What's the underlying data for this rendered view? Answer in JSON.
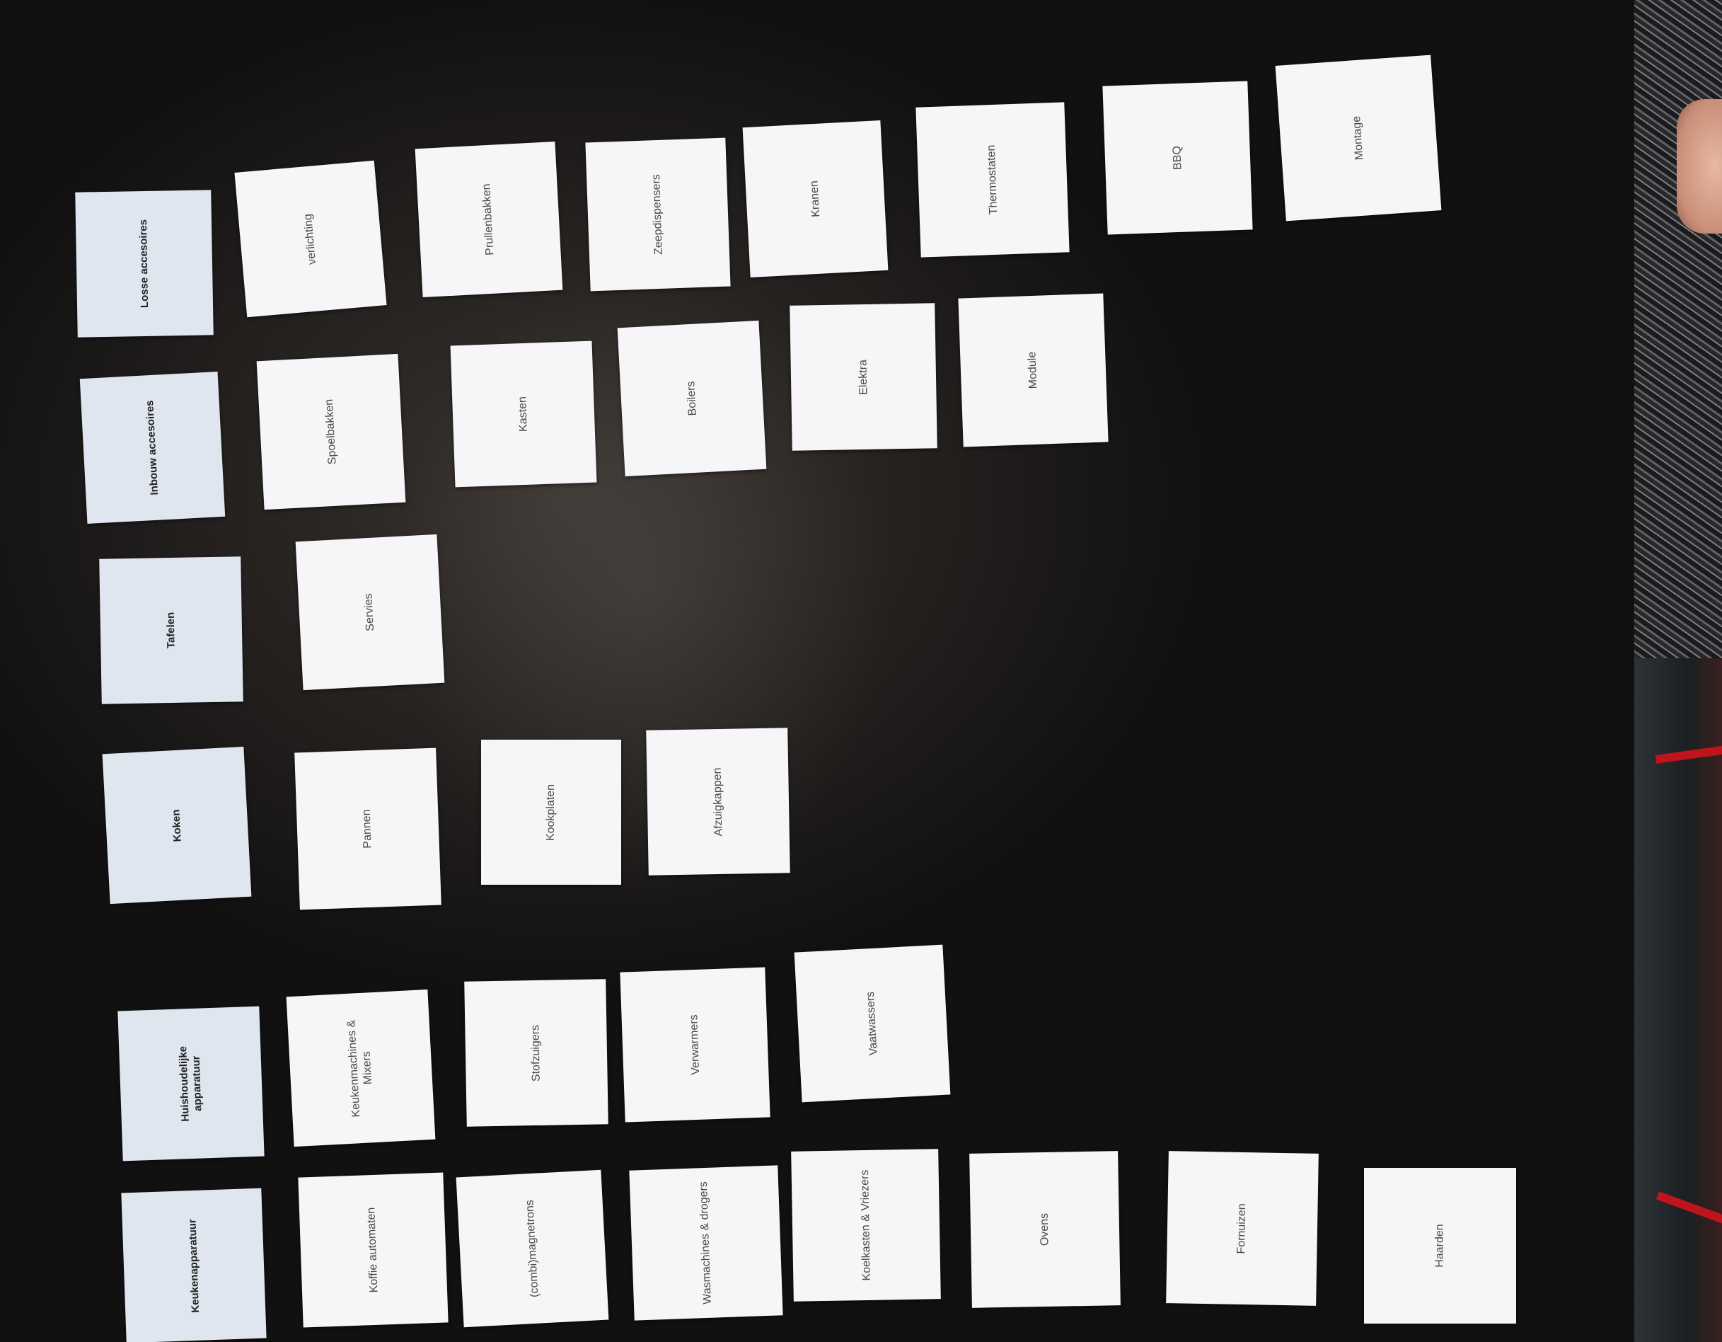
{
  "cards": {
    "col1": {
      "header": "Losse accesoires",
      "items": [
        "verlichting",
        "Prullenbakken",
        "Zeepdispensers",
        "Kranen",
        "Thermostaten",
        "BBQ",
        "Montage"
      ]
    },
    "col2": {
      "header": "Inbouw accesoires",
      "items": [
        "Spoelbakken",
        "Kasten",
        "Boilers",
        "Elektra",
        "Module"
      ]
    },
    "col3": {
      "header": "Tafelen",
      "items": [
        "Servies"
      ]
    },
    "col4": {
      "header": "Koken",
      "items": [
        "Pannen",
        "Kookplaten",
        "Afzuigkappen"
      ]
    },
    "col5": {
      "header": "Huishoudelijke apparatuur",
      "items": [
        "Keukenmachines & Mixers",
        "Stofzuigers",
        "Verwarmers",
        "Vaatwassers"
      ]
    },
    "col6": {
      "header": "Keukenapparatuur",
      "items": [
        "Koffie automaten",
        "(combi)magnetrons",
        "Wasmachines & drogers",
        "Koelkasten & Vriezers",
        "Ovens",
        "Fornuizen",
        "Haarden"
      ]
    }
  }
}
